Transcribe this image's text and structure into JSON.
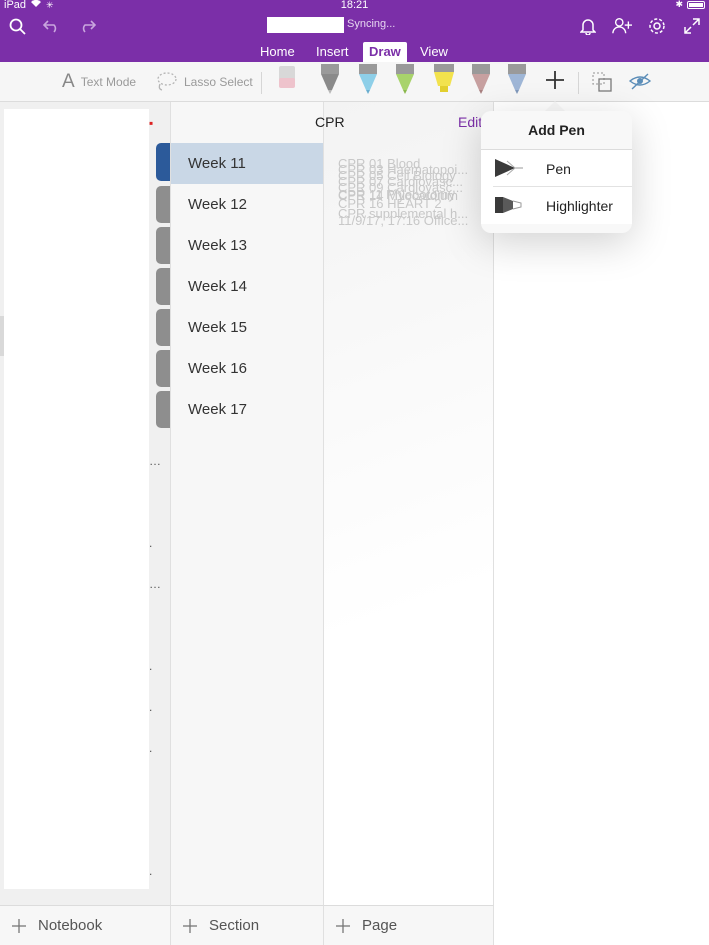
{
  "status_bar": {
    "device": "iPad",
    "time": "18:21"
  },
  "toolbar": {
    "sync_status": "Syncing..."
  },
  "ribbon": {
    "tabs": [
      {
        "label": "Home"
      },
      {
        "label": "Insert"
      },
      {
        "label": "Draw"
      },
      {
        "label": "View"
      }
    ],
    "active_tab": "Draw"
  },
  "draw_tools": {
    "text_mode": "Text Mode",
    "lasso_select": "Lasso Select",
    "pens": [
      {
        "color": "#b7b7b7"
      },
      {
        "color": "#8ecfe8"
      },
      {
        "color": "#a8d36b"
      },
      {
        "color": "#f2e24d"
      },
      {
        "color": "#c7a0a0"
      },
      {
        "color": "#9fb6d6"
      }
    ]
  },
  "section_list": {
    "title": "CPR",
    "edit_label": "Edit",
    "items": [
      {
        "label": "Week 11"
      },
      {
        "label": "Week 12"
      },
      {
        "label": "Week 13"
      },
      {
        "label": "Week 14"
      },
      {
        "label": "Week 15"
      },
      {
        "label": "Week 16"
      },
      {
        "label": "Week 17"
      }
    ],
    "active_index": 0
  },
  "page_list": {
    "ghost_lines": [
      "CPR 01 Blood",
      "CPR 03 Haematopoi...",
      "CPR 05 Cell Biology",
      "CPR 07 Cardiovasc...",
      "CPR 09 Cardiovasc...",
      "CPR 11 Phlebotomy",
      "CPR 14 Myocardium",
      "CPR 16 HEART 2",
      "CPR supplemental h...",
      "11/9/17, 17:16 Office..."
    ]
  },
  "add_pen_popover": {
    "title": "Add Pen",
    "options": [
      {
        "label": "Pen"
      },
      {
        "label": "Highlighter"
      }
    ]
  },
  "bottom_bar": {
    "notebook": "Notebook",
    "section": "Section",
    "page": "Page"
  },
  "colors": {
    "brand": "#7b2fa8",
    "active_section_bg": "#c9d7e6",
    "active_section_tab": "#2c5a9a"
  }
}
